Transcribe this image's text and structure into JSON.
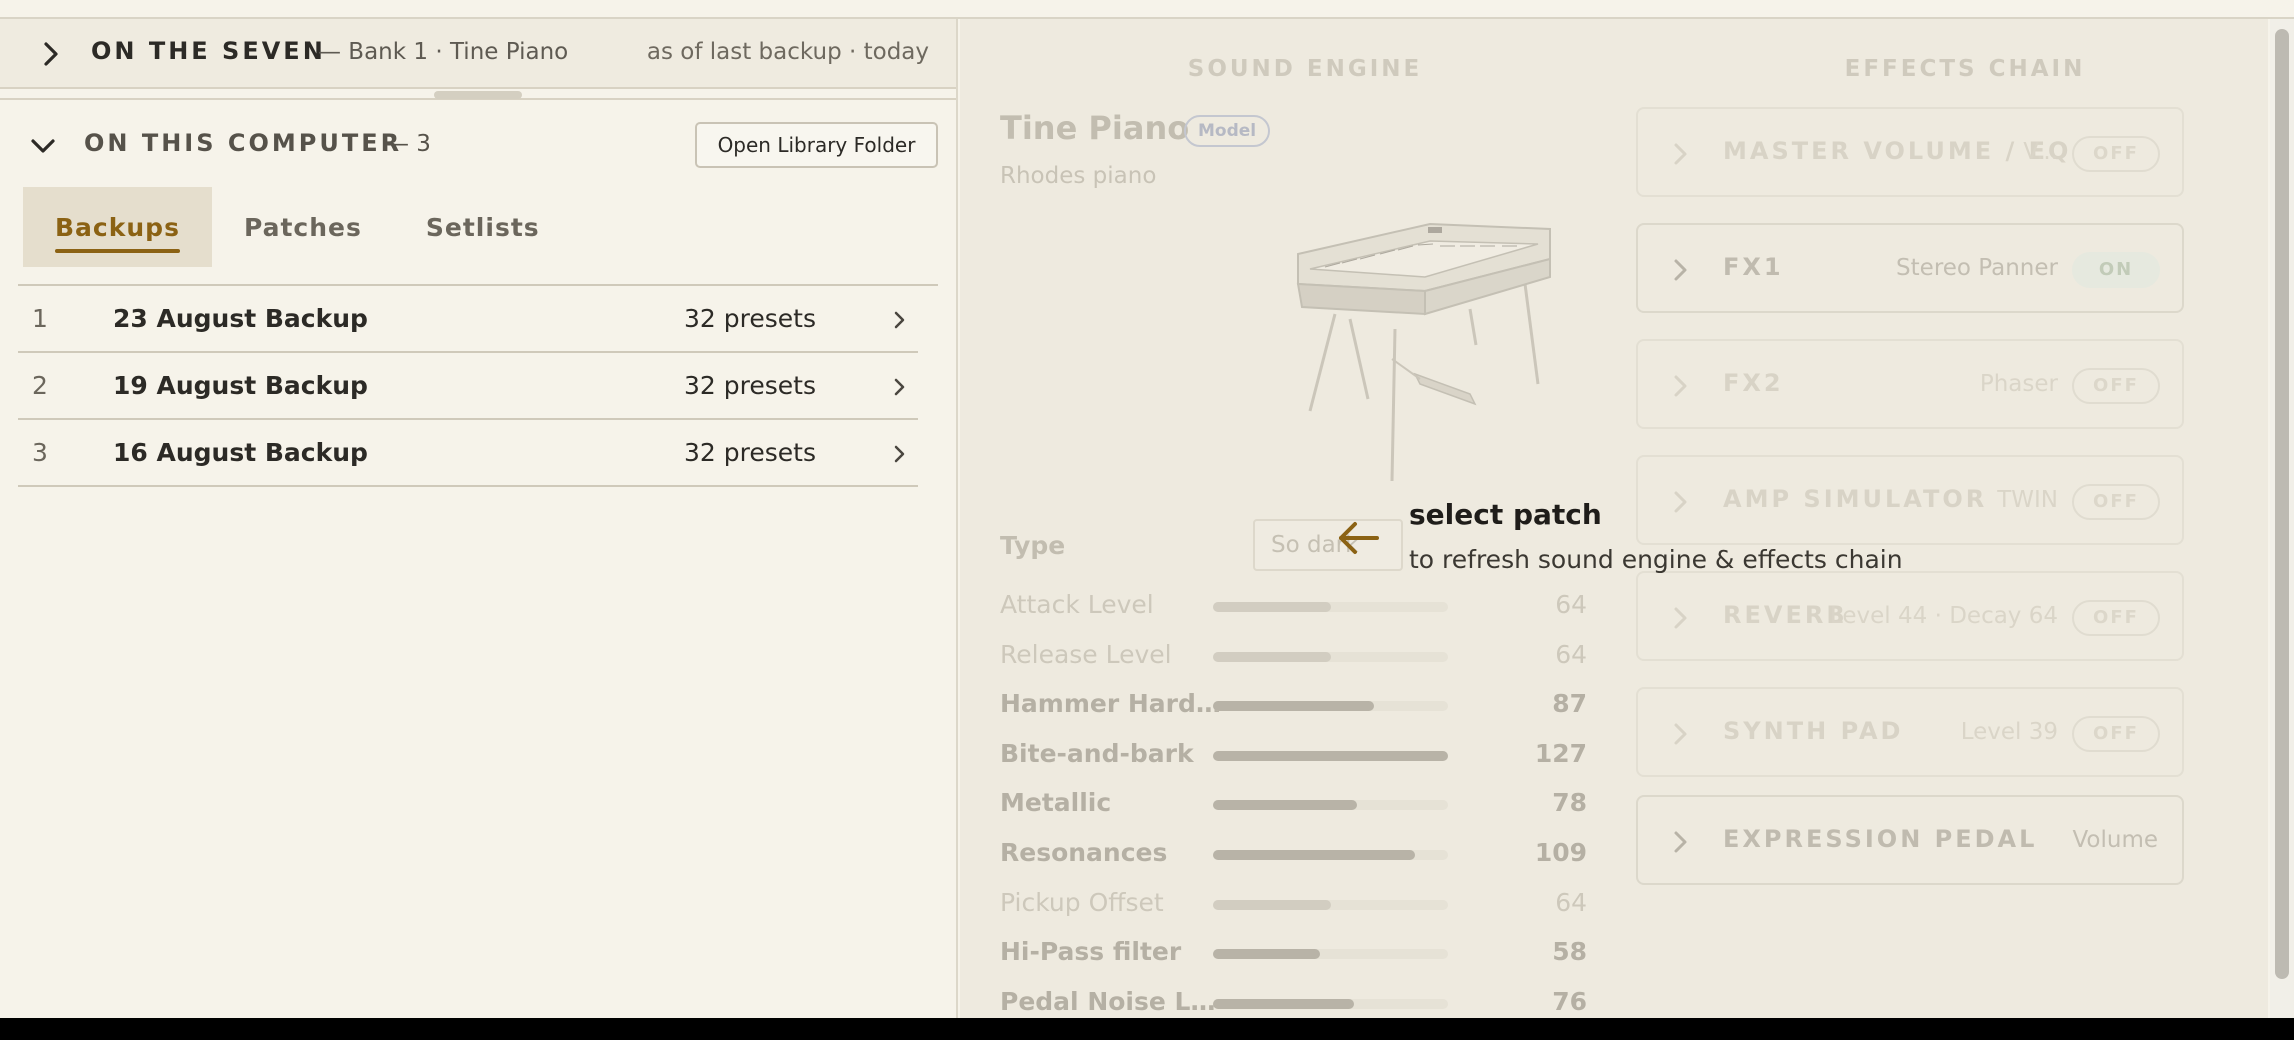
{
  "device": {
    "title": "ON THE SEVEN",
    "subtitle": "— Bank 1 · Tine Piano",
    "status": "as of last backup · today"
  },
  "computer": {
    "title": "ON THIS COMPUTER",
    "count": "— 3",
    "open_folder_label": "Open Library Folder",
    "tabs": [
      {
        "label": "Backups",
        "active": true
      },
      {
        "label": "Patches",
        "active": false
      },
      {
        "label": "Setlists",
        "active": false
      }
    ],
    "backups": [
      {
        "num": "1",
        "name": "23 August Backup",
        "count": "32 presets"
      },
      {
        "num": "2",
        "name": "19 August Backup",
        "count": "32 presets"
      },
      {
        "num": "3",
        "name": "16 August Backup",
        "count": "32 presets"
      }
    ]
  },
  "sound_engine": {
    "heading": "SOUND ENGINE",
    "name": "Tine Piano",
    "badge": "Model",
    "description": "Rhodes piano",
    "type_label": "Type",
    "type_value": "So dark",
    "params": [
      {
        "label": "Attack Level",
        "value": 64,
        "max": 127,
        "strong": false
      },
      {
        "label": "Release Level",
        "value": 64,
        "max": 127,
        "strong": false
      },
      {
        "label": "Hammer Hardne...",
        "value": 87,
        "max": 127,
        "strong": true
      },
      {
        "label": "Bite-and-bark",
        "value": 127,
        "max": 127,
        "strong": true
      },
      {
        "label": "Metallic",
        "value": 78,
        "max": 127,
        "strong": true
      },
      {
        "label": "Resonances",
        "value": 109,
        "max": 127,
        "strong": true
      },
      {
        "label": "Pickup Offset",
        "value": 64,
        "max": 127,
        "strong": false
      },
      {
        "label": "Hi-Pass filter",
        "value": 58,
        "max": 127,
        "strong": true
      },
      {
        "label": "Pedal Noise Level",
        "value": 76,
        "max": 127,
        "strong": true
      }
    ]
  },
  "effects_chain": {
    "heading": "EFFECTS CHAIN",
    "items": [
      {
        "name": "MASTER VOLUME / EQ",
        "value": "V...",
        "toggle": "OFF",
        "bright": false
      },
      {
        "name": "FX1",
        "value": "Stereo Panner",
        "toggle": "ON",
        "bright": true
      },
      {
        "name": "FX2",
        "value": "Phaser",
        "toggle": "OFF",
        "bright": false
      },
      {
        "name": "AMP SIMULATOR",
        "value": "TWIN",
        "toggle": "OFF",
        "bright": false
      },
      {
        "name": "REVERB",
        "value": "Level 44 · Decay 64",
        "toggle": "OFF",
        "bright": false
      },
      {
        "name": "SYNTH PAD",
        "value": "Level 39",
        "toggle": "OFF",
        "bright": false
      },
      {
        "name": "EXPRESSION PEDAL",
        "value": "Volume",
        "toggle": "",
        "bright": true
      }
    ]
  },
  "hint": {
    "title": "select patch",
    "text": "to refresh sound engine & effects chain"
  },
  "colors": {
    "accent": "#8b6214",
    "background": "#f6f3ea",
    "panel": "#eeeadf"
  }
}
